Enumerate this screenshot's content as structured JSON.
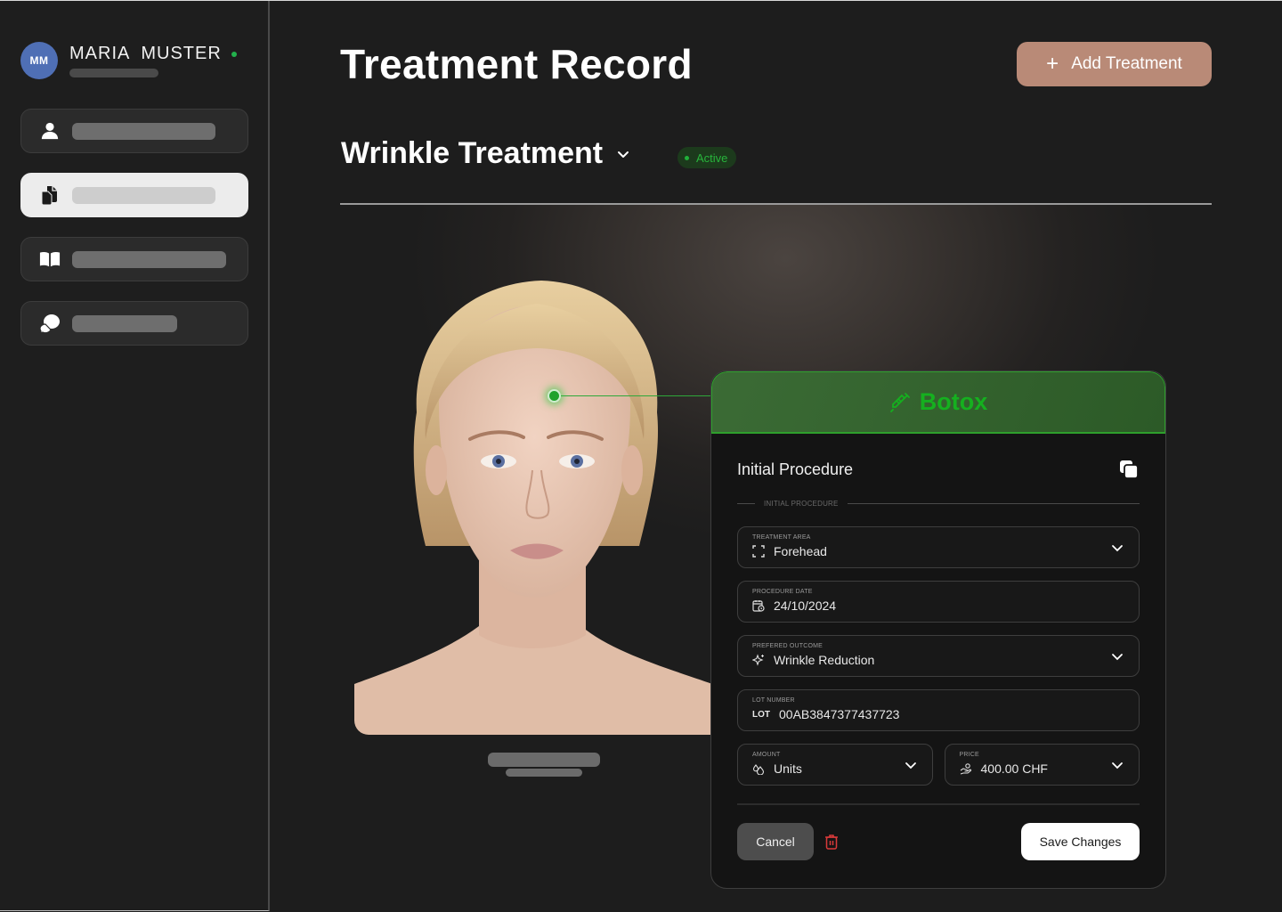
{
  "user": {
    "initials": "MM",
    "name": "MARIA  MUSTER",
    "online": true
  },
  "sidebar": {
    "items": [
      {
        "icon": "user-icon",
        "active": false
      },
      {
        "icon": "documents-icon",
        "active": true
      },
      {
        "icon": "book-icon",
        "active": false
      },
      {
        "icon": "chat-icon",
        "active": false
      }
    ]
  },
  "header": {
    "title": "Treatment Record",
    "add_button_label": "Add Treatment",
    "add_button_icon": "plus-icon"
  },
  "treatment": {
    "name": "Wrinkle Treatment",
    "status": "Active"
  },
  "colors": {
    "accent": "#b98a77",
    "success": "#20b03a",
    "avatar": "#4f6fb5",
    "danger": "#d93a3a"
  },
  "card": {
    "product": "Botox",
    "product_icon": "syringe-icon",
    "section_title": "Initial Procedure",
    "section_label": "INITIAL PROCEDURE",
    "fields": {
      "treatment_area": {
        "label": "TREATMENT AREA",
        "value": "Forehead",
        "icon": "focus-frame-icon"
      },
      "procedure_date": {
        "label": "PROCEDURE DATE",
        "value": "24/10/2024",
        "icon": "calendar-clock-icon"
      },
      "preferred_outcome": {
        "label": "PREFERED OUTCOME",
        "value": "Wrinkle Reduction",
        "icon": "sparkles-icon"
      },
      "lot_number": {
        "label": "LOT NUMBER",
        "prefix": "LOT",
        "value": "00AB3847377437723"
      },
      "amount": {
        "label": "AMOUNT",
        "value": "Units",
        "icon": "droplets-icon"
      },
      "price": {
        "label": "PRICE",
        "value": "400.00 CHF",
        "icon": "hand-coins-icon"
      }
    },
    "cancel_label": "Cancel",
    "save_label": "Save Changes"
  }
}
